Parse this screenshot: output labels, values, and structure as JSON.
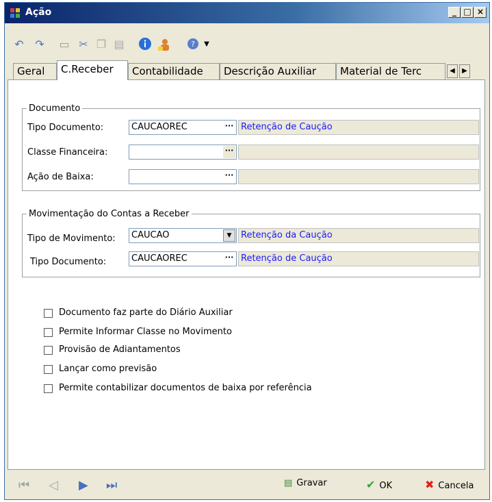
{
  "window": {
    "title": "Ação"
  },
  "toolbar": {
    "icons": [
      "undo-icon",
      "redo-icon",
      "new-icon",
      "cut-icon",
      "copy-icon",
      "paste-icon",
      "info-icon",
      "users-icon",
      "help-icon"
    ]
  },
  "tabs": [
    {
      "label": "Geral"
    },
    {
      "label": "C.Receber"
    },
    {
      "label": "Contabilidade"
    },
    {
      "label": "Descrição Auxiliar"
    },
    {
      "label": "Material de Terc"
    }
  ],
  "documento": {
    "legend": "Documento",
    "tipo_documento": {
      "label": "Tipo Documento:",
      "value": "CAUCAOREC",
      "description": "Retenção de Caução"
    },
    "classe_financeira": {
      "label": "Classe Financeira:",
      "value": "",
      "description": ""
    },
    "acao_baixa": {
      "label": "Ação de Baixa:",
      "value": "",
      "description": ""
    }
  },
  "movimentacao": {
    "legend": "Movimentação do Contas a Receber",
    "tipo_movimento": {
      "label": "Tipo de Movimento:",
      "value": "CAUCAO",
      "description": "Retenção da Caução"
    },
    "tipo_documento": {
      "label": "Tipo Documento:",
      "value": "CAUCAOREC",
      "description": "Retenção de Caução"
    }
  },
  "options": [
    {
      "label": "Documento faz parte do Diário Auxiliar",
      "checked": false
    },
    {
      "label": "Permite Informar Classe no Movimento",
      "checked": false
    },
    {
      "label": "Provisão de Adiantamentos",
      "checked": false
    },
    {
      "label": "Lançar como previsão",
      "checked": false
    },
    {
      "label": "Permite contabilizar documentos de baixa por referência",
      "checked": false
    }
  ],
  "actions": {
    "save": "Gravar",
    "ok": "OK",
    "cancel": "Cancela"
  },
  "colors": {
    "accent": "#1a1aff",
    "titlebar": "#0a246a"
  }
}
